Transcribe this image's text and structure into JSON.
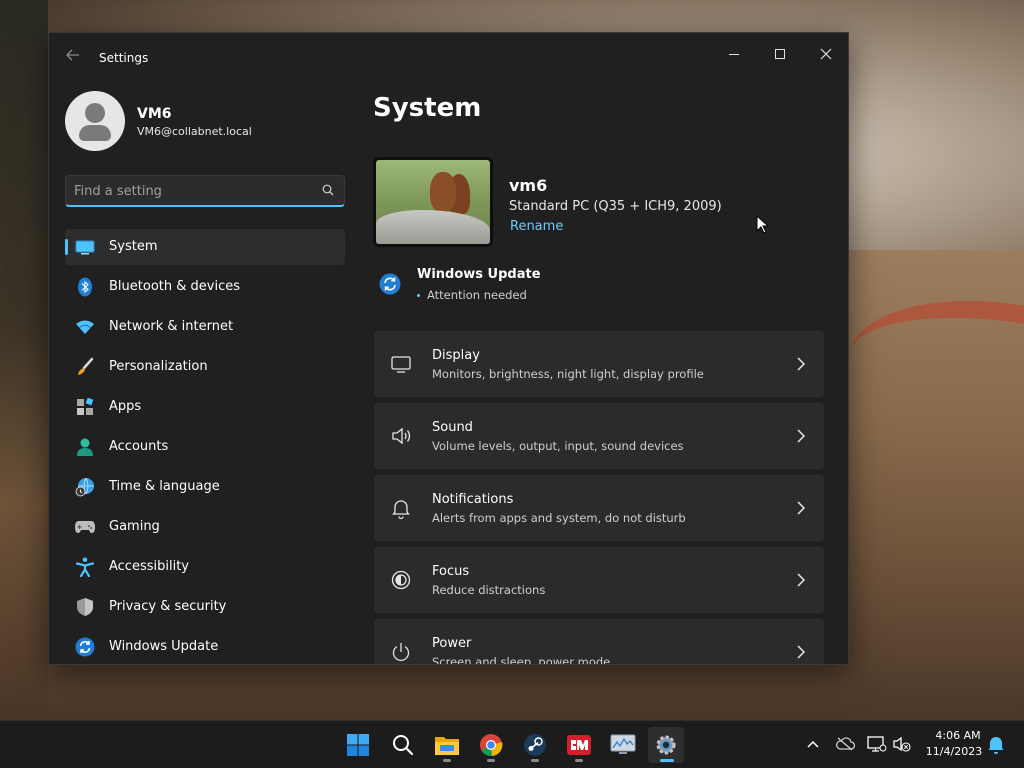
{
  "window": {
    "title": "Settings",
    "controls": {
      "minimize": "minimize",
      "maximize": "maximize",
      "close": "close"
    }
  },
  "account": {
    "name": "VM6",
    "email": "VM6@collabnet.local"
  },
  "search": {
    "placeholder": "Find a setting"
  },
  "nav": {
    "items": [
      {
        "label": "System",
        "icon": "system-icon",
        "active": true
      },
      {
        "label": "Bluetooth & devices",
        "icon": "bluetooth-icon"
      },
      {
        "label": "Network & internet",
        "icon": "wifi-icon"
      },
      {
        "label": "Personalization",
        "icon": "brush-icon"
      },
      {
        "label": "Apps",
        "icon": "apps-icon"
      },
      {
        "label": "Accounts",
        "icon": "accounts-icon"
      },
      {
        "label": "Time & language",
        "icon": "globe-clock-icon"
      },
      {
        "label": "Gaming",
        "icon": "gamepad-icon"
      },
      {
        "label": "Accessibility",
        "icon": "accessibility-icon"
      },
      {
        "label": "Privacy & security",
        "icon": "shield-icon"
      },
      {
        "label": "Windows Update",
        "icon": "update-icon"
      }
    ]
  },
  "main": {
    "title": "System",
    "device": {
      "name": "vm6",
      "model": "Standard PC (Q35 + ICH9, 2009)",
      "rename": "Rename"
    },
    "update": {
      "title": "Windows Update",
      "status": "Attention needed"
    },
    "cards": [
      {
        "title": "Display",
        "subtitle": "Monitors, brightness, night light, display profile",
        "icon": "monitor-icon"
      },
      {
        "title": "Sound",
        "subtitle": "Volume levels, output, input, sound devices",
        "icon": "speaker-icon"
      },
      {
        "title": "Notifications",
        "subtitle": "Alerts from apps and system, do not disturb",
        "icon": "bell-icon"
      },
      {
        "title": "Focus",
        "subtitle": "Reduce distractions",
        "icon": "focus-icon"
      },
      {
        "title": "Power",
        "subtitle": "Screen and sleep, power mode",
        "icon": "power-icon"
      }
    ]
  },
  "taskbar": {
    "apps": [
      "start-icon",
      "search-icon",
      "file-explorer-icon",
      "chrome-icon",
      "steam-icon",
      "red-app-icon",
      "monitor-app-icon",
      "settings-icon"
    ],
    "clock": {
      "time": "4:06 AM",
      "date": "11/4/2023"
    }
  },
  "colors": {
    "accent": "#4cc2ff",
    "link": "#6ccbff",
    "window_bg": "#202020",
    "card_bg": "#2b2b2b"
  }
}
